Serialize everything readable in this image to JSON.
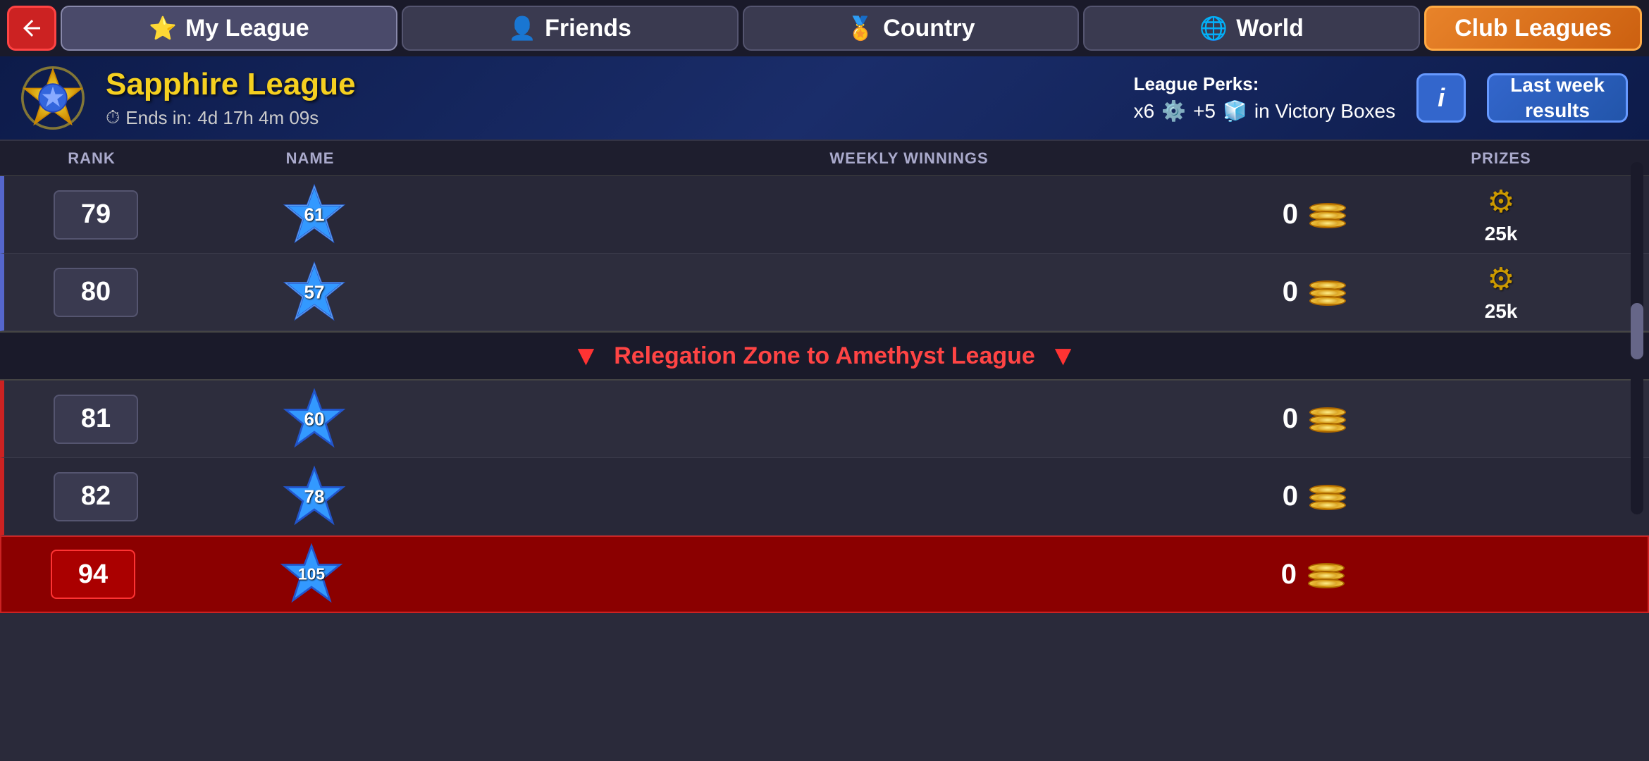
{
  "nav": {
    "back_label": "◀",
    "tabs": [
      {
        "id": "my-league",
        "label": "My League",
        "icon": "⭐",
        "active": true
      },
      {
        "id": "friends",
        "label": "Friends",
        "icon": "👤"
      },
      {
        "id": "country",
        "label": "Country",
        "icon": "🏅"
      },
      {
        "id": "world",
        "label": "World",
        "icon": "🌐"
      }
    ],
    "club_leagues_label": "Club Leagues"
  },
  "league": {
    "name": "Sapphire League",
    "timer_label": "Ends in:",
    "timer_value": "4d 17h 4m 09s",
    "perks_label": "League Perks:",
    "perks_multiplier": "x6",
    "perks_bonus": "+5",
    "perks_suffix": "in Victory Boxes",
    "info_label": "i",
    "last_week_label": "Last week\nresults"
  },
  "columns": {
    "rank": "RANK",
    "name": "NAME",
    "weekly_winnings": "WEEKLY WINNINGS",
    "prizes": "PRIZES"
  },
  "rows": [
    {
      "rank": 79,
      "star_level": 61,
      "winnings": 0,
      "prize_value": "25k",
      "zone": "normal"
    },
    {
      "rank": 80,
      "star_level": 57,
      "winnings": 0,
      "prize_value": "25k",
      "zone": "normal"
    },
    {
      "rank": 81,
      "star_level": 60,
      "winnings": 0,
      "prize_value": null,
      "zone": "relegation"
    },
    {
      "rank": 82,
      "star_level": 78,
      "winnings": 0,
      "prize_value": null,
      "zone": "relegation"
    },
    {
      "rank": 94,
      "star_level": 105,
      "winnings": 0,
      "prize_value": null,
      "zone": "highlighted"
    }
  ],
  "relegation_banner": {
    "text": "Relegation Zone to Amethyst League",
    "arrow": "▼"
  }
}
